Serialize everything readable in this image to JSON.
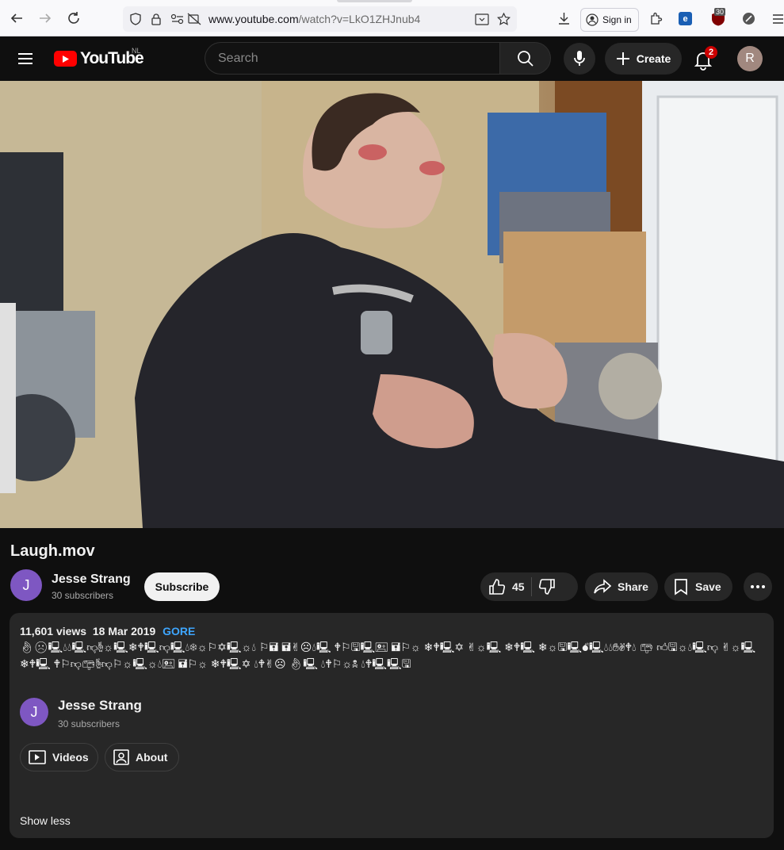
{
  "browser": {
    "url_domain": "www.youtube.com",
    "url_path": "/watch?v=LkO1ZHJnub4",
    "sign_in_label": "Sign in",
    "ext_badge": "30"
  },
  "header": {
    "logo_text": "YouTube",
    "country_code": "NL",
    "search_placeholder": "Search",
    "create_label": "Create",
    "notification_count": "2",
    "account_initial": "R"
  },
  "video": {
    "title": "Laugh.mov"
  },
  "channel": {
    "name": "Jesse Strang",
    "initial": "J",
    "subscribers": "30 subscribers",
    "subscribe_label": "Subscribe"
  },
  "actions": {
    "like_count": "45",
    "share_label": "Share",
    "save_label": "Save"
  },
  "description": {
    "views": "11,601 views",
    "date": "18 Mar 2019",
    "tag": "GORE",
    "text": "👌︎☹︎🖳︎💧︎💧︎🖳︎👎︎✌︎☼︎🖳︎❄︎🕈︎🖳︎👎︎🖳︎💧︎❄︎☼︎⚐︎✡︎🖳︎☼︎💧︎ ⚐︎🖬︎ 🖬︎✌︎☹︎💧︎🖳︎ 🕈︎⚐︎🖫︎🖳︎🖭︎ 🖬︎⚐︎☼︎ ❄︎🕈︎🖳︎✡︎ ✌︎☼︎🖳︎ ❄︎🕈︎🖳︎ ❄︎☼︎🖫︎🖳︎💣︎🖳︎💧︎💧︎✋︎✌︎🕈︎💧︎ 📪︎ 👍︎🖫︎☼︎💧︎🖳︎👎︎ ✌︎☼︎🖳︎ ❄︎🕈︎🖳︎ 🕈︎⚐︎👎︎📪︎✌︎👎︎⚐︎☼︎🖳︎☼︎💧︎🖭︎ 🖬︎⚐︎☼︎ ❄︎🕈︎🖳︎✡︎ 💧︎🕈︎✌︎☹︎ 👌︎🖳︎ 💧︎🕈︎⚐︎☼︎🕱︎ 💧︎🕈︎🖳︎🖳︎🖫︎"
  },
  "about": {
    "name": "Jesse Strang",
    "initial": "J",
    "subscribers": "30 subscribers",
    "videos_label": "Videos",
    "about_label": "About",
    "show_less_label": "Show less"
  },
  "colors": {
    "youtube_red": "#ff0000",
    "link_blue": "#3ea6ff",
    "channel_avatar": "#7e57c2",
    "account_avatar": "#a1887f"
  }
}
